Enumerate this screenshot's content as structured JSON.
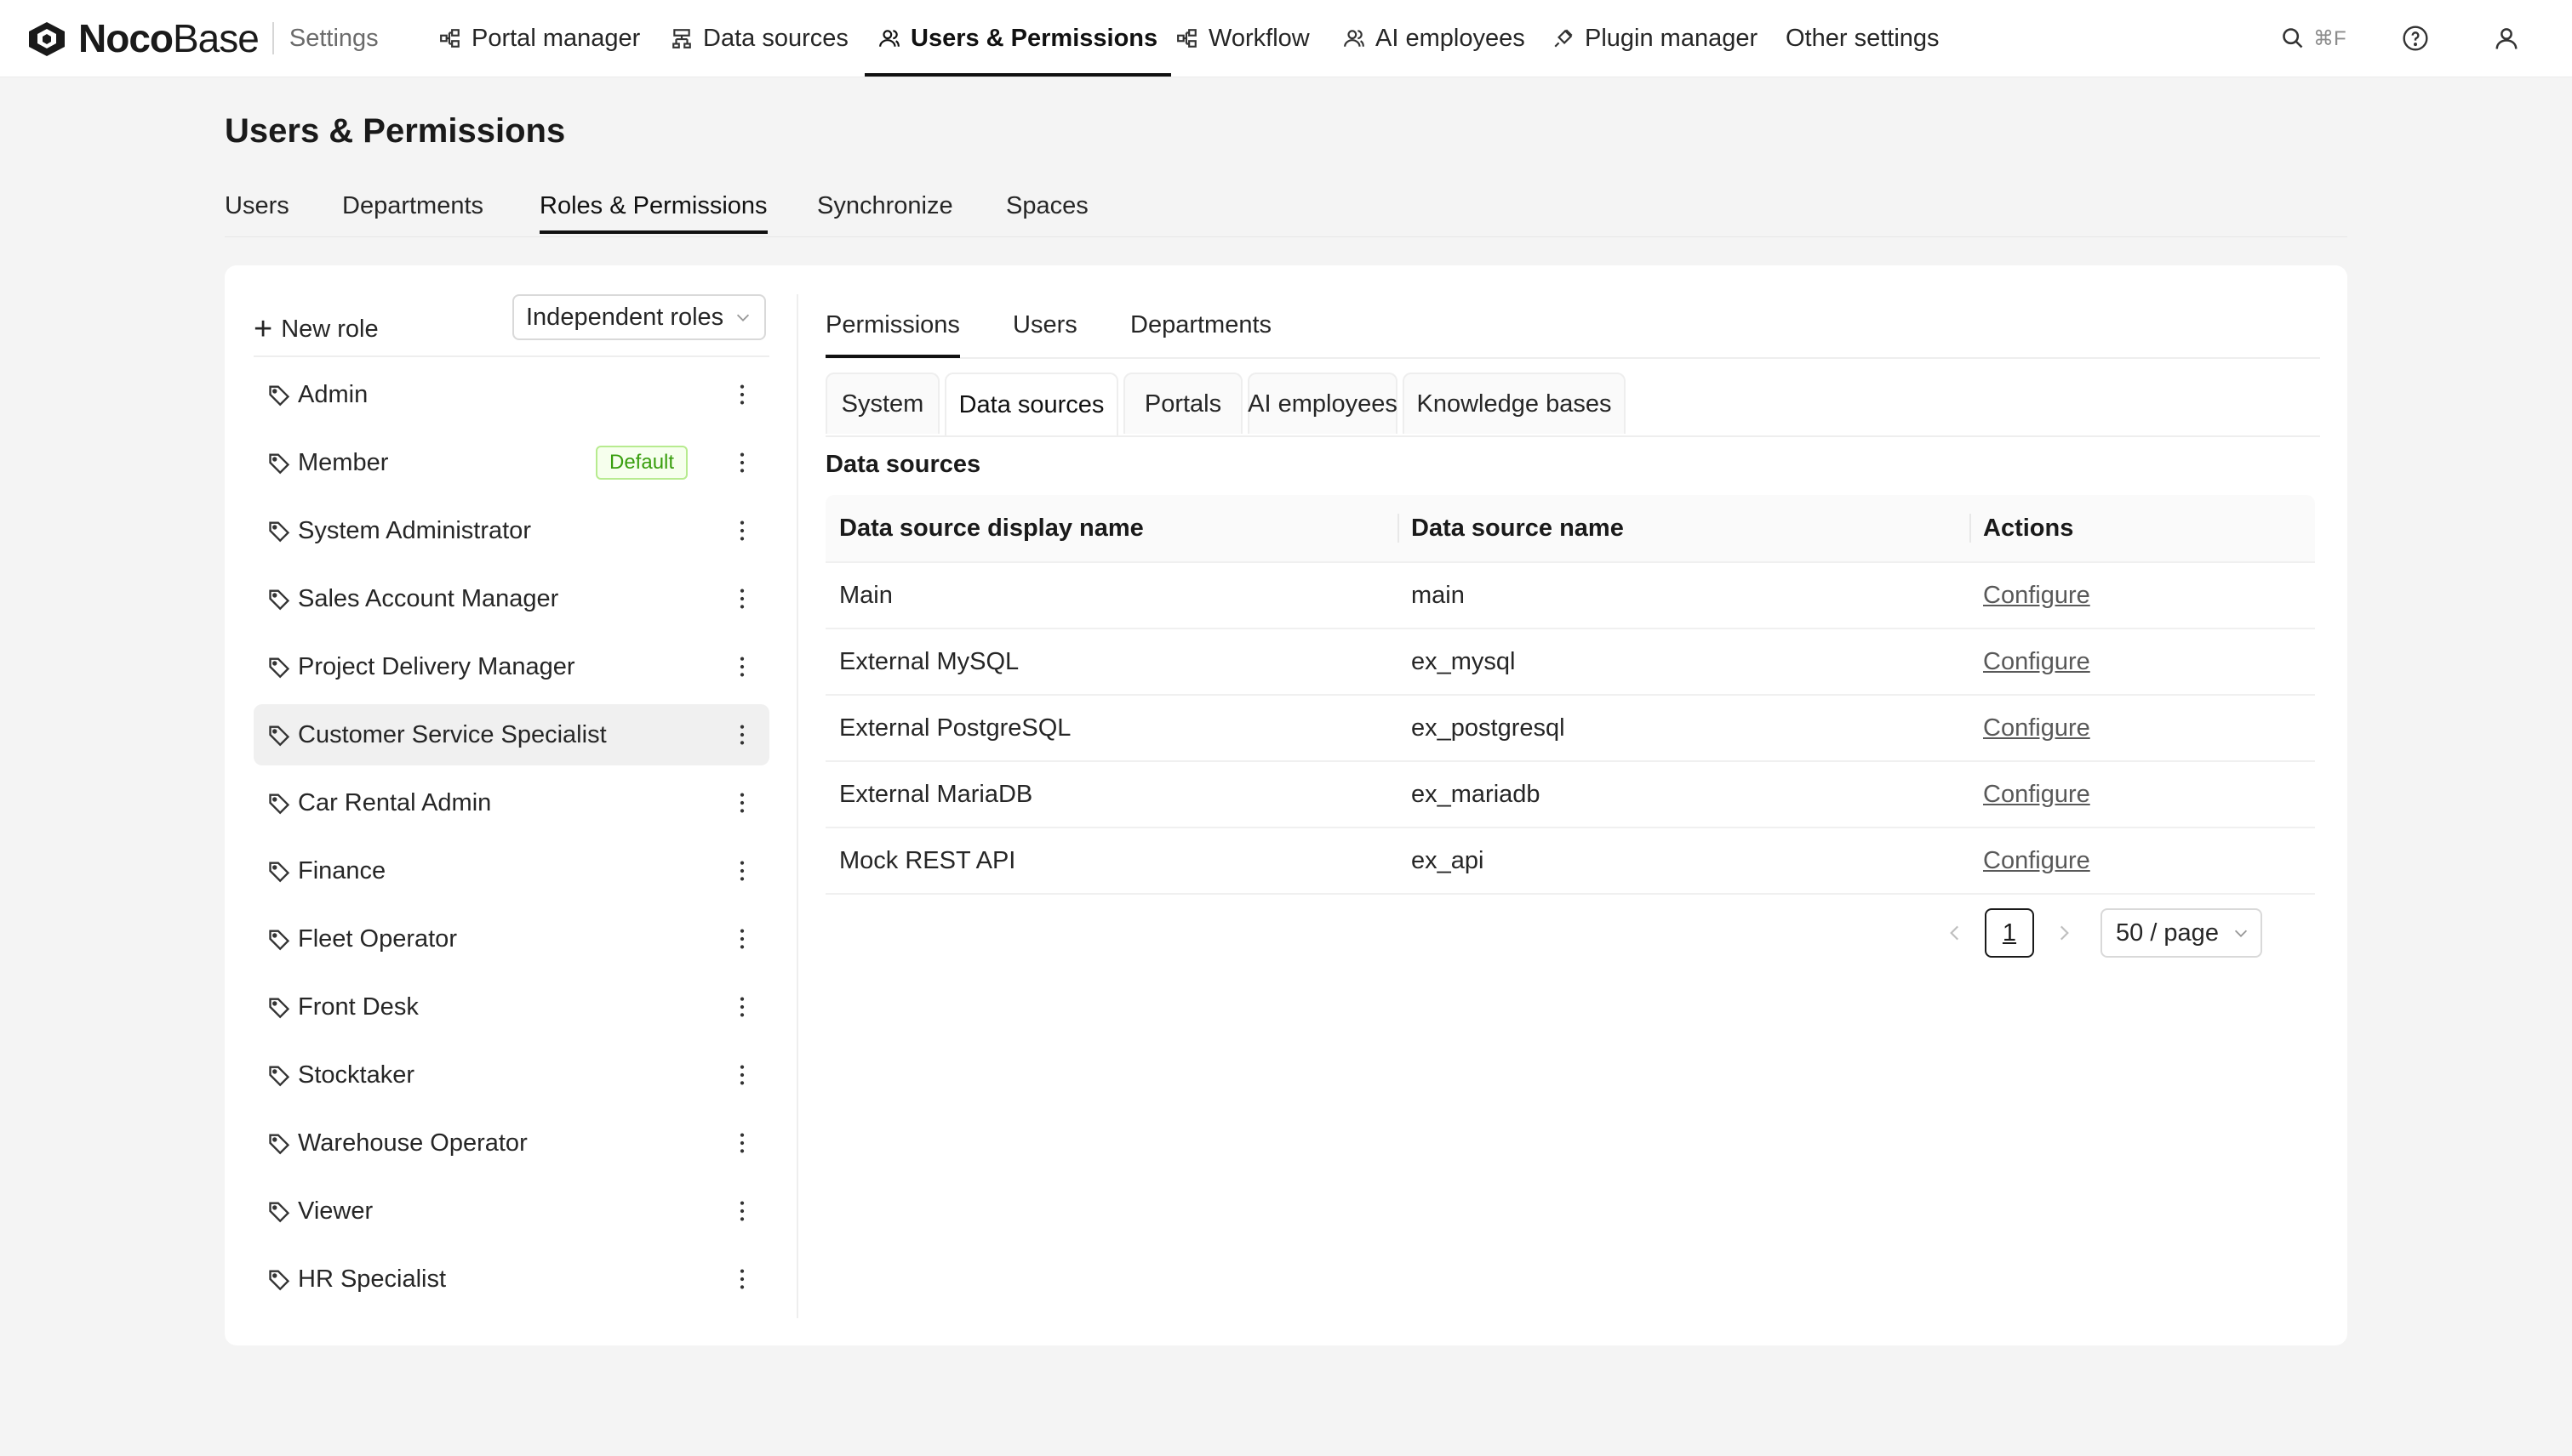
{
  "topbar": {
    "brand_strong": "Noco",
    "brand_light": "Base",
    "settings_label": "Settings",
    "nav": [
      {
        "label": "Portal manager",
        "icon": "portal-icon"
      },
      {
        "label": "Data sources",
        "icon": "database-icon"
      },
      {
        "label": "Users & Permissions",
        "icon": "users-icon",
        "active": true
      },
      {
        "label": "Workflow",
        "icon": "workflow-icon"
      },
      {
        "label": "AI employees",
        "icon": "ai-employee-icon"
      },
      {
        "label": "Plugin manager",
        "icon": "plugin-icon"
      },
      {
        "label": "Other settings",
        "icon": ""
      }
    ],
    "search_shortcut": "⌘F"
  },
  "page": {
    "title": "Users & Permissions",
    "tabs": [
      "Users",
      "Departments",
      "Roles & Permissions",
      "Synchronize",
      "Spaces"
    ],
    "active_tab": "Roles & Permissions"
  },
  "roles_panel": {
    "new_role_label": "New role",
    "mode_select": "Independent roles",
    "default_badge": "Default",
    "selected_role": "Customer Service Specialist",
    "roles": [
      "Admin",
      "Member",
      "System Administrator",
      "Sales Account Manager",
      "Project Delivery Manager",
      "Customer Service Specialist",
      "Car Rental Admin",
      "Finance",
      "Fleet Operator",
      "Front Desk",
      "Stocktaker",
      "Warehouse Operator",
      "Viewer",
      "HR Specialist"
    ]
  },
  "detail": {
    "sub_tabs": [
      "Permissions",
      "Users",
      "Departments"
    ],
    "card_tabs": [
      "System",
      "Data sources",
      "Portals",
      "AI employees",
      "Knowledge bases"
    ],
    "active_card_tab": "Data sources",
    "section_title": "Data sources",
    "table": {
      "columns": [
        "Data source display name",
        "Data source name",
        "Actions"
      ],
      "rows": [
        {
          "display": "Main",
          "name": "main",
          "action": "Configure"
        },
        {
          "display": "External MySQL",
          "name": "ex_mysql",
          "action": "Configure"
        },
        {
          "display": "External PostgreSQL",
          "name": "ex_postgresql",
          "action": "Configure"
        },
        {
          "display": "External MariaDB",
          "name": "ex_mariadb",
          "action": "Configure"
        },
        {
          "display": "Mock REST API",
          "name": "ex_api",
          "action": "Configure"
        }
      ]
    },
    "pagination": {
      "current_page": "1",
      "page_size": "50 / page"
    }
  }
}
